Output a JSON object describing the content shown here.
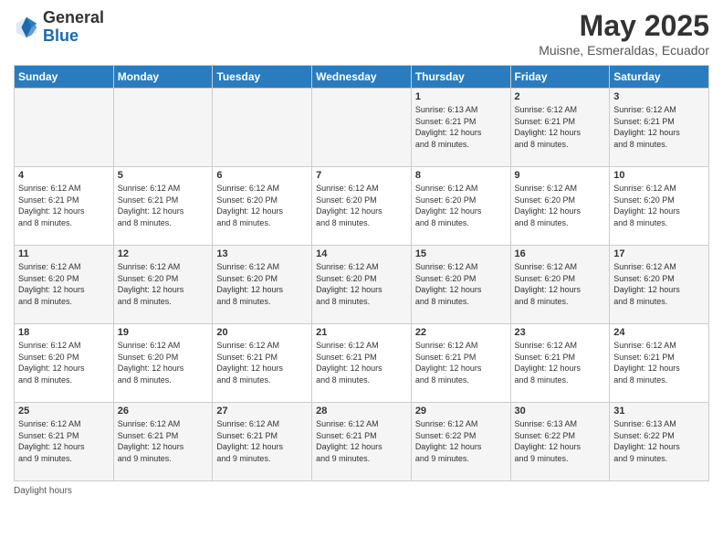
{
  "header": {
    "logo_general": "General",
    "logo_blue": "Blue",
    "main_title": "May 2025",
    "subtitle": "Muisne, Esmeraldas, Ecuador"
  },
  "days_of_week": [
    "Sunday",
    "Monday",
    "Tuesday",
    "Wednesday",
    "Thursday",
    "Friday",
    "Saturday"
  ],
  "weeks": [
    [
      {
        "day": "",
        "info": ""
      },
      {
        "day": "",
        "info": ""
      },
      {
        "day": "",
        "info": ""
      },
      {
        "day": "",
        "info": ""
      },
      {
        "day": "1",
        "info": "Sunrise: 6:13 AM\nSunset: 6:21 PM\nDaylight: 12 hours\nand 8 minutes."
      },
      {
        "day": "2",
        "info": "Sunrise: 6:12 AM\nSunset: 6:21 PM\nDaylight: 12 hours\nand 8 minutes."
      },
      {
        "day": "3",
        "info": "Sunrise: 6:12 AM\nSunset: 6:21 PM\nDaylight: 12 hours\nand 8 minutes."
      }
    ],
    [
      {
        "day": "4",
        "info": "Sunrise: 6:12 AM\nSunset: 6:21 PM\nDaylight: 12 hours\nand 8 minutes."
      },
      {
        "day": "5",
        "info": "Sunrise: 6:12 AM\nSunset: 6:21 PM\nDaylight: 12 hours\nand 8 minutes."
      },
      {
        "day": "6",
        "info": "Sunrise: 6:12 AM\nSunset: 6:20 PM\nDaylight: 12 hours\nand 8 minutes."
      },
      {
        "day": "7",
        "info": "Sunrise: 6:12 AM\nSunset: 6:20 PM\nDaylight: 12 hours\nand 8 minutes."
      },
      {
        "day": "8",
        "info": "Sunrise: 6:12 AM\nSunset: 6:20 PM\nDaylight: 12 hours\nand 8 minutes."
      },
      {
        "day": "9",
        "info": "Sunrise: 6:12 AM\nSunset: 6:20 PM\nDaylight: 12 hours\nand 8 minutes."
      },
      {
        "day": "10",
        "info": "Sunrise: 6:12 AM\nSunset: 6:20 PM\nDaylight: 12 hours\nand 8 minutes."
      }
    ],
    [
      {
        "day": "11",
        "info": "Sunrise: 6:12 AM\nSunset: 6:20 PM\nDaylight: 12 hours\nand 8 minutes."
      },
      {
        "day": "12",
        "info": "Sunrise: 6:12 AM\nSunset: 6:20 PM\nDaylight: 12 hours\nand 8 minutes."
      },
      {
        "day": "13",
        "info": "Sunrise: 6:12 AM\nSunset: 6:20 PM\nDaylight: 12 hours\nand 8 minutes."
      },
      {
        "day": "14",
        "info": "Sunrise: 6:12 AM\nSunset: 6:20 PM\nDaylight: 12 hours\nand 8 minutes."
      },
      {
        "day": "15",
        "info": "Sunrise: 6:12 AM\nSunset: 6:20 PM\nDaylight: 12 hours\nand 8 minutes."
      },
      {
        "day": "16",
        "info": "Sunrise: 6:12 AM\nSunset: 6:20 PM\nDaylight: 12 hours\nand 8 minutes."
      },
      {
        "day": "17",
        "info": "Sunrise: 6:12 AM\nSunset: 6:20 PM\nDaylight: 12 hours\nand 8 minutes."
      }
    ],
    [
      {
        "day": "18",
        "info": "Sunrise: 6:12 AM\nSunset: 6:20 PM\nDaylight: 12 hours\nand 8 minutes."
      },
      {
        "day": "19",
        "info": "Sunrise: 6:12 AM\nSunset: 6:20 PM\nDaylight: 12 hours\nand 8 minutes."
      },
      {
        "day": "20",
        "info": "Sunrise: 6:12 AM\nSunset: 6:21 PM\nDaylight: 12 hours\nand 8 minutes."
      },
      {
        "day": "21",
        "info": "Sunrise: 6:12 AM\nSunset: 6:21 PM\nDaylight: 12 hours\nand 8 minutes."
      },
      {
        "day": "22",
        "info": "Sunrise: 6:12 AM\nSunset: 6:21 PM\nDaylight: 12 hours\nand 8 minutes."
      },
      {
        "day": "23",
        "info": "Sunrise: 6:12 AM\nSunset: 6:21 PM\nDaylight: 12 hours\nand 8 minutes."
      },
      {
        "day": "24",
        "info": "Sunrise: 6:12 AM\nSunset: 6:21 PM\nDaylight: 12 hours\nand 8 minutes."
      }
    ],
    [
      {
        "day": "25",
        "info": "Sunrise: 6:12 AM\nSunset: 6:21 PM\nDaylight: 12 hours\nand 9 minutes."
      },
      {
        "day": "26",
        "info": "Sunrise: 6:12 AM\nSunset: 6:21 PM\nDaylight: 12 hours\nand 9 minutes."
      },
      {
        "day": "27",
        "info": "Sunrise: 6:12 AM\nSunset: 6:21 PM\nDaylight: 12 hours\nand 9 minutes."
      },
      {
        "day": "28",
        "info": "Sunrise: 6:12 AM\nSunset: 6:21 PM\nDaylight: 12 hours\nand 9 minutes."
      },
      {
        "day": "29",
        "info": "Sunrise: 6:12 AM\nSunset: 6:22 PM\nDaylight: 12 hours\nand 9 minutes."
      },
      {
        "day": "30",
        "info": "Sunrise: 6:13 AM\nSunset: 6:22 PM\nDaylight: 12 hours\nand 9 minutes."
      },
      {
        "day": "31",
        "info": "Sunrise: 6:13 AM\nSunset: 6:22 PM\nDaylight: 12 hours\nand 9 minutes."
      }
    ]
  ],
  "footer": {
    "daylight_hours_label": "Daylight hours"
  }
}
